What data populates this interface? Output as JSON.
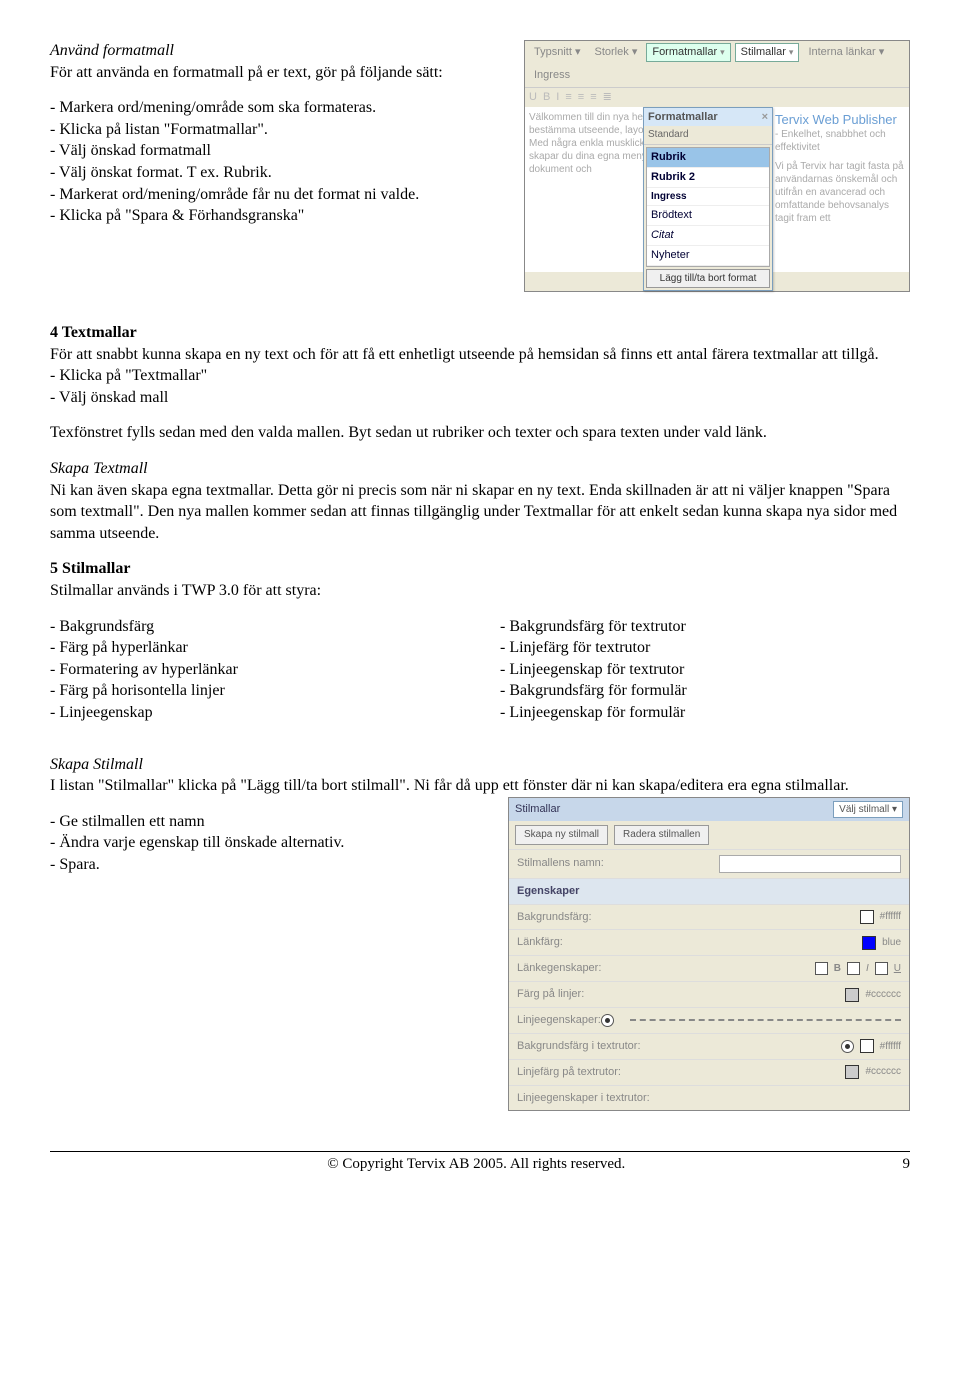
{
  "section1": {
    "title": "Använd formatmall",
    "intro": "För att använda en formatmall på er text, gör på följande sätt:",
    "items": [
      "- Markera ord/mening/område som ska formateras.",
      "- Klicka på listan \"Formatmallar\".",
      "- Välj önskad  formatmall",
      "- Välj önskat format. T ex. Rubrik.",
      "- Markerat ord/mening/område får nu det format ni valde.",
      "- Klicka på \"Spara & Förhandsgranska\""
    ]
  },
  "editor_shot": {
    "toolbar_dropdowns": [
      "Typsnitt",
      "Storlek",
      "Formatmallar",
      "Stilmallar",
      "Interna länkar",
      "Ingress"
    ],
    "toolbar_icons": [
      "U",
      "B",
      "I"
    ],
    "panel_title": "Formatmallar",
    "panel_subtitle": "Standard",
    "panel_items": [
      "Rubrik",
      "Rubrik 2",
      "Ingress",
      "Brödtext",
      "Citat",
      "Nyheter"
    ],
    "panel_button": "Lägg till/ta bort format",
    "left_placeholder": "Välkommen till din nya hemsida. Här kan du bestämma utseende, layout och innehåll helt fritt. Med några enkla musklick och knapptryckningar skapar du dina egna menyer och texter, sparar bilder, dokument och",
    "brand_title": "Tervix Web Publisher",
    "brand_sub": "- Enkelhet, snabbhet och effektivitet",
    "brand_text": "Vi på Tervix har tagit fasta på användarnas önskemål och utifrån en avancerad och omfattande behovsanalys tagit fram ett"
  },
  "section2": {
    "title": "4 Textmallar",
    "p1": "För att snabbt kunna skapa en ny text och för att få ett enhetligt utseende på hemsidan så finns ett antal färera textmallar att tillgå.",
    "items": [
      "- Klicka på \"Textmallar\"",
      "- Välj önskad mall"
    ],
    "p2": "Texfönstret fylls sedan med den valda mallen. Byt sedan ut rubriker och texter och spara texten under vald länk."
  },
  "section3": {
    "title": "Skapa Textmall",
    "text": "Ni kan även skapa egna textmallar. Detta gör ni precis som när ni skapar en ny text. Enda skillnaden är att ni väljer knappen \"Spara som textmall\". Den nya mallen kommer sedan att finnas tillgänglig under Textmallar för att enkelt sedan kunna skapa nya sidor med samma utseende."
  },
  "section4": {
    "title": "5 Stilmallar",
    "intro": "Stilmallar används i TWP 3.0 för att styra:",
    "col1": [
      "- Bakgrundsfärg",
      "- Färg på hyperlänkar",
      "- Formatering av hyperlänkar",
      "- Färg på horisontella linjer",
      "- Linjeegenskap"
    ],
    "col2": [
      "- Bakgrundsfärg för textrutor",
      "- Linjefärg för textrutor",
      "- Linjeegenskap för textrutor",
      "- Bakgrundsfärg för formulär",
      "- Linjeegenskap för formulär"
    ]
  },
  "section5": {
    "title": "Skapa Stilmall",
    "p1": "I listan \"Stilmallar\" klicka på \"Lägg till/ta bort stilmall\". Ni får då upp ett fönster där ni kan skapa/editera era egna stilmallar.",
    "items": [
      "- Ge stilmallen ett namn",
      "- Ändra varje egenskap till önskade alternativ.",
      "- Spara."
    ]
  },
  "style_shot": {
    "header": "Stilmallar",
    "select_placeholder": "Välj stilmall",
    "buttons": [
      "Skapa ny stilmall",
      "Radera stilmallen"
    ],
    "name_label": "Stilmallens namn:",
    "props_header": "Egenskaper",
    "rows": [
      {
        "label": "Bakgrundsfärg:",
        "swatch": "#ffffff",
        "text": "#ffffff"
      },
      {
        "label": "Länkfärg:",
        "swatch": "#0000ff",
        "text": "blue"
      },
      {
        "label": "Länkegenskaper:",
        "biu": true
      },
      {
        "label": "Färg på linjer:",
        "swatch": "#cccccc",
        "text": "#cccccc"
      },
      {
        "label": "Linjeegenskaper:",
        "dashed": true
      },
      {
        "label": "Bakgrundsfärg i textrutor:",
        "swatch": "#ffffff",
        "text": "#ffffff",
        "radio": true
      },
      {
        "label": "Linjefärg på textrutor:",
        "swatch": "#cccccc",
        "text": "#cccccc"
      },
      {
        "label": "Linjeegenskaper i textrutor:"
      }
    ]
  },
  "footer": {
    "copyright": "© Copyright Tervix AB 2005. All rights reserved.",
    "page": "9"
  }
}
